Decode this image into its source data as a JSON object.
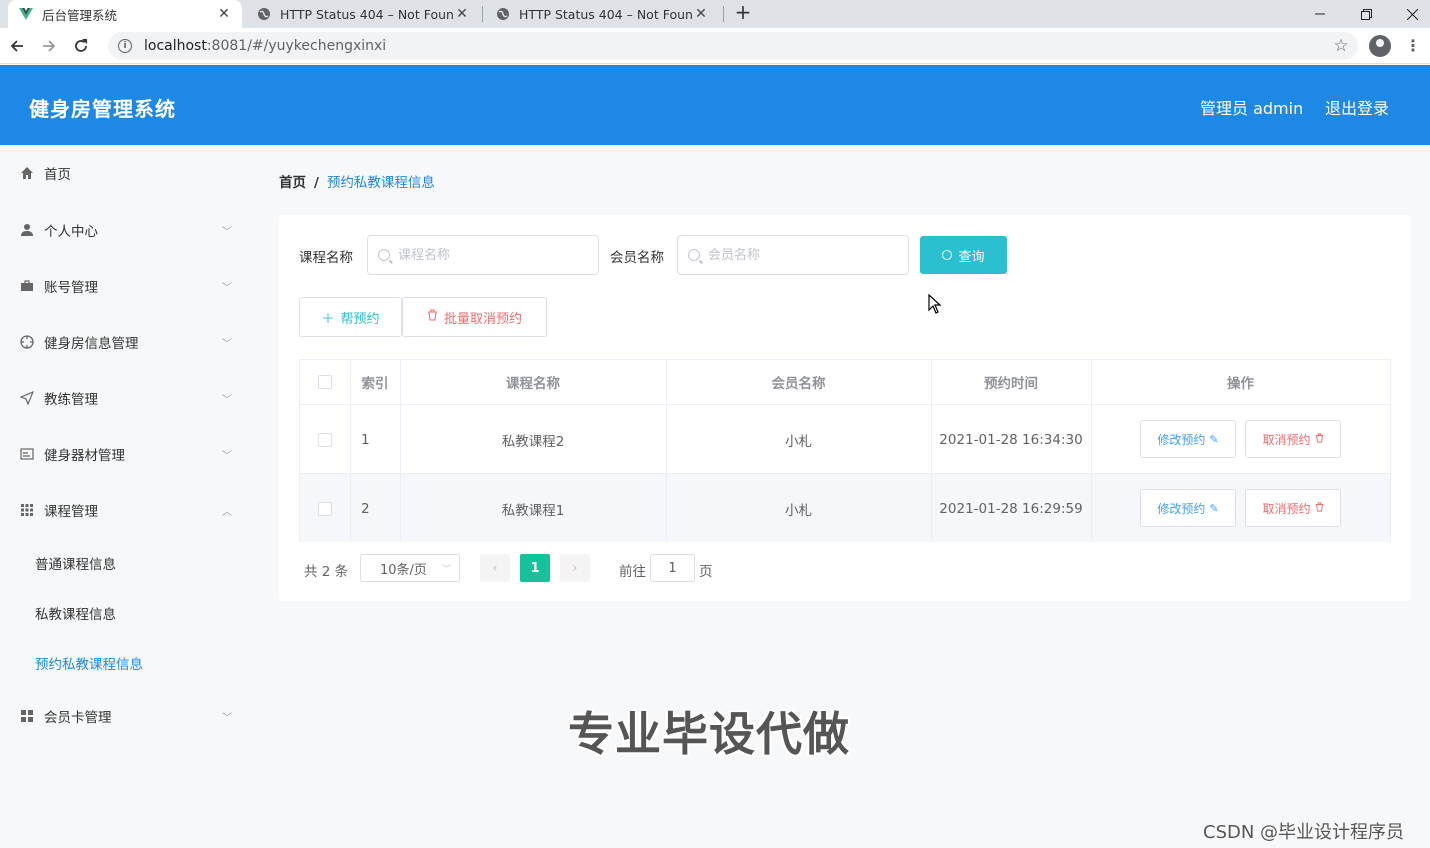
{
  "browser": {
    "tabs": [
      {
        "title": "后台管理系统",
        "active": true
      },
      {
        "title": "HTTP Status 404 – Not Found",
        "active": false
      },
      {
        "title": "HTTP Status 404 – Not Found",
        "active": false
      }
    ],
    "url_host": "localhost",
    "url_rest": ":8081/#/yuykechengxinxi",
    "close_glyph": "✕",
    "newtab_glyph": "+"
  },
  "header": {
    "title": "健身房管理系统",
    "user_label": "管理员 admin",
    "logout_label": "退出登录",
    "color": "#1e88e5"
  },
  "sidebar": {
    "items": [
      {
        "label": "首页",
        "icon": "home-icon"
      },
      {
        "label": "个人中心",
        "icon": "user-icon"
      },
      {
        "label": "账号管理",
        "icon": "briefcase-icon"
      },
      {
        "label": "健身房信息管理",
        "icon": "compass-icon"
      },
      {
        "label": "教练管理",
        "icon": "send-icon"
      },
      {
        "label": "健身器材管理",
        "icon": "card-icon"
      },
      {
        "label": "课程管理",
        "icon": "grid-icon"
      },
      {
        "label": "会员卡管理",
        "icon": "apps-icon"
      }
    ],
    "sub_items": [
      {
        "label": "普通课程信息",
        "active": false
      },
      {
        "label": "私教课程信息",
        "active": false
      },
      {
        "label": "预约私教课程信息",
        "active": true
      }
    ]
  },
  "breadcrumb": {
    "home": "首页",
    "separator": "/",
    "current": "预约私教课程信息"
  },
  "search": {
    "course_label": "课程名称",
    "course_placeholder": "课程名称",
    "member_label": "会员名称",
    "member_placeholder": "会员名称",
    "query_label": "查询"
  },
  "actions": {
    "add_label": "帮预约",
    "batch_cancel_label": "批量取消预约"
  },
  "table": {
    "headers": [
      "索引",
      "课程名称",
      "会员名称",
      "预约时间",
      "操作"
    ],
    "rows": [
      {
        "index": "1",
        "course": "私教课程2",
        "member": "小札",
        "time": "2021-01-28 16:34:30"
      },
      {
        "index": "2",
        "course": "私教课程1",
        "member": "小札",
        "time": "2021-01-28 16:29:59"
      }
    ],
    "edit_label": "修改预约",
    "cancel_label": "取消预约"
  },
  "pagination": {
    "total_text": "共 2 条",
    "page_size": "10条/页",
    "current_page": "1",
    "goto_label": "前往",
    "goto_value": "1",
    "page_suffix": "页"
  },
  "overlay": {
    "watermark": "专业毕设代做",
    "csdn": "CSDN @毕业设计程序员"
  },
  "colors": {
    "accent": "#1e88e5",
    "query_button": "#2bc0d0",
    "danger": "#f56c6c",
    "page_active": "#16c29a"
  }
}
